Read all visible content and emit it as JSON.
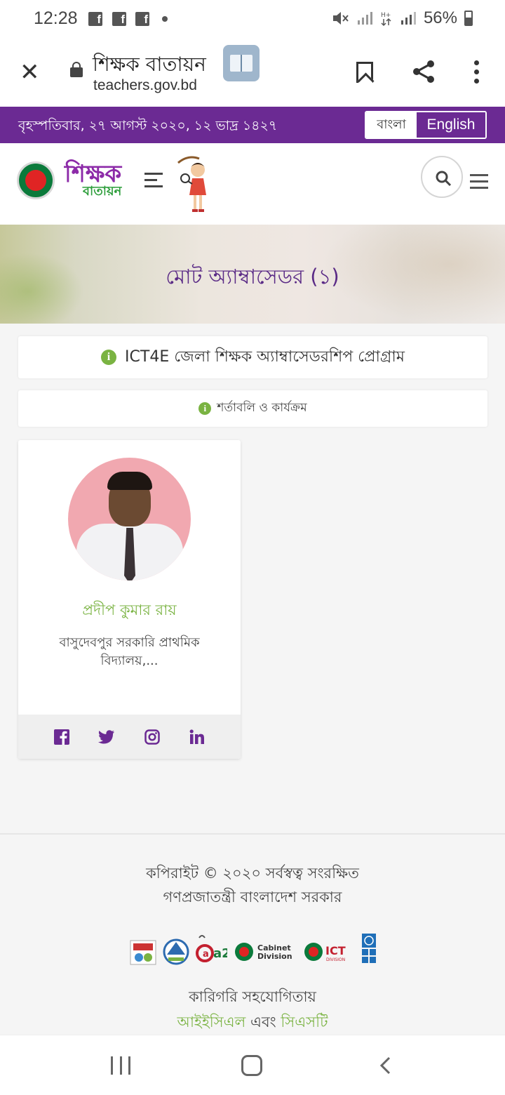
{
  "status_bar": {
    "time": "12:28",
    "notification_icons": [
      "facebook-icon",
      "facebook-icon",
      "facebook-icon"
    ],
    "battery": "56%"
  },
  "browser": {
    "title": "শিক্ষক বাতায়ন",
    "url": "teachers.gov.bd"
  },
  "date_bar": {
    "date": "বৃহস্পতিবার, ২৭ আগস্ট ২০২০, ১২ ভাদ্র ১৪২৭",
    "lang_bn": "বাংলা",
    "lang_en": "English"
  },
  "header": {
    "logo_main": "শিক্ষক",
    "logo_sub": "বাতায়ন"
  },
  "hero": {
    "title": "মোট অ্যাম্বাসেডর (১)"
  },
  "info": {
    "program": "ICT4E জেলা শিক্ষক অ্যাম্বাসেডরশিপ প্রোগ্রাম",
    "terms": "শর্তাবলি ও কার্যক্রম"
  },
  "ambassadors": [
    {
      "name": "প্রদীপ কুমার রায়",
      "school": "বাসুদেবপুর সরকারি প্রাথমিক বিদ্যালয়,..."
    }
  ],
  "footer": {
    "copyright_line1": "কপিরাইট © ২০২০ সর্বস্বত্ব সংরক্ষিত",
    "copyright_line2": "গণপ্রজাতন্ত্রী বাংলাদেশ সরকার",
    "partner_labels": [
      "a2i",
      "Cabinet",
      "Division",
      "ICT",
      "DIVISION"
    ],
    "tech_label": "কারিগরি সহযোগিতায়",
    "tech_org1": "আইইসিএল",
    "tech_and": "এবং",
    "tech_org2": "সিএসটি"
  },
  "colors": {
    "brand_purple": "#6b2a93",
    "accent_green": "#7ab342"
  }
}
